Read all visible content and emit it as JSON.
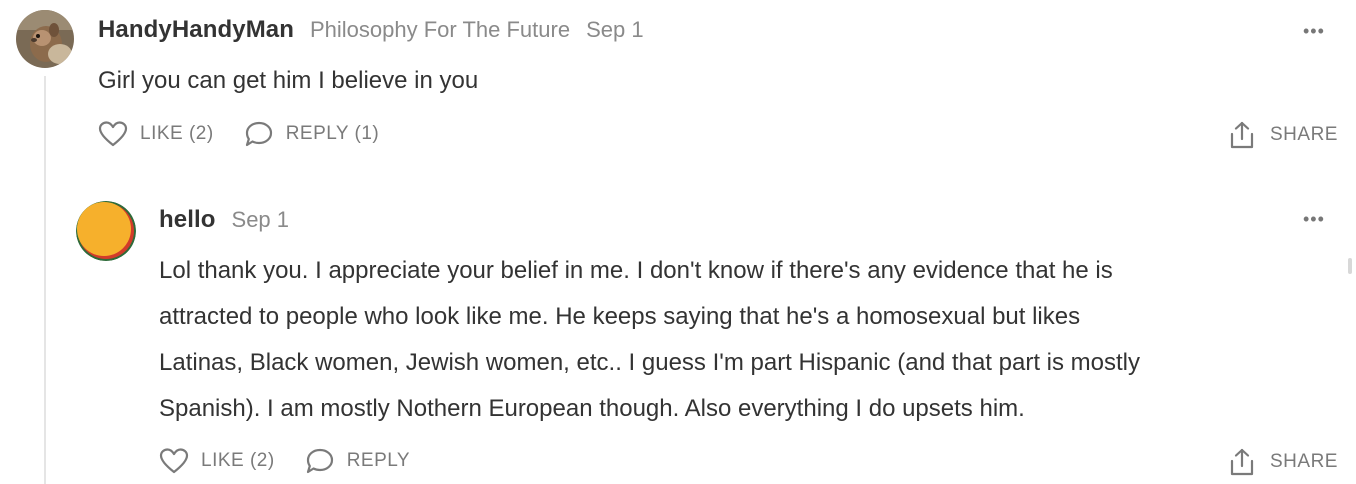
{
  "comment": {
    "author": "HandyHandyMan",
    "publication": "Philosophy For The Future",
    "date": "Sep 1",
    "more_label": "•••",
    "text": "Girl you can get him I believe in you",
    "like_label": "LIKE (2)",
    "reply_label": "REPLY (1)",
    "share_label": "SHARE"
  },
  "reply": {
    "author": "hello",
    "date": "Sep 1",
    "more_label": "•••",
    "text_lines": [
      "Lol thank you. I appreciate your belief in me. I don't know if there's any evidence that he is",
      "attracted to people who look like me. He keeps saying that he's a homosexual but likes",
      "Latinas, Black women, Jewish women, etc.. I guess I'm part Hispanic (and that part is mostly",
      "Spanish). I am mostly Nothern European though. Also everything I do upsets him."
    ],
    "like_label": "LIKE (2)",
    "reply_label": "REPLY",
    "share_label": "SHARE"
  },
  "icons": {
    "avatar_1": "squirrel-photo-avatar",
    "avatar_2": "orange-circle-avatar",
    "like": "heart-icon",
    "reply": "speech-bubble-icon",
    "share": "share-upload-icon",
    "more": "ellipsis-icon"
  },
  "colors": {
    "text": "#333333",
    "muted": "#8a8a8a",
    "action": "#7a7a7a",
    "thread_line": "#e5e5e5",
    "avatar_orange": "#f6b02c"
  }
}
